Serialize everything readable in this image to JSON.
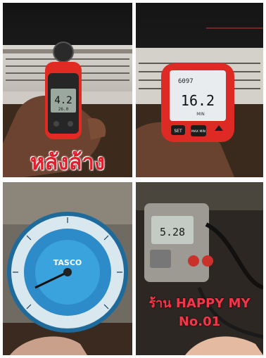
{
  "photos": {
    "anemometer": {
      "caption": "หลังล้าง",
      "reading": "4.2",
      "sub_reading": "26.0"
    },
    "thermometer": {
      "top_reading": "6097",
      "main_reading": "16.2",
      "mode_label": "MIN",
      "buttons": {
        "set": "SET",
        "max_min": "MAX MIN"
      }
    },
    "pressure_gauge": {
      "brand": "TASCO"
    },
    "clamp_meter": {
      "reading": "5.28",
      "shop_line1": "ร้าน HAPPY MY",
      "shop_line2": "No.01"
    }
  }
}
